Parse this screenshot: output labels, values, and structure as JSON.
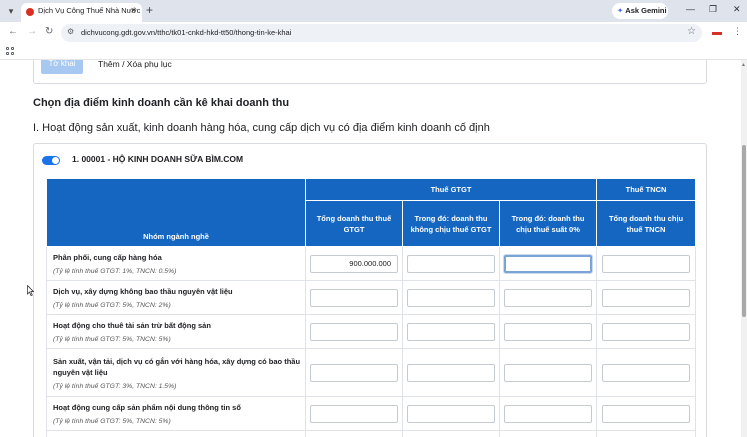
{
  "browser": {
    "tab_title": "Dịch Vụ Công Thuế Nhà Nước",
    "new_tab_symbol": "+",
    "ask_gemini_label": "Ask Gemini",
    "url": "dichvucong.gdt.gov.vn/tthc/tk01-cnkd-hkd-tt50/thong-tin-ke-khai",
    "colors": {
      "tabstrip": "#dfe3eb",
      "accent": "#1a73e8",
      "table_header": "#1566c0"
    }
  },
  "page": {
    "top_buttons": {
      "tokhai_label": "Tờ khai",
      "phuluc_label": "Thêm / Xóa phụ lục"
    },
    "section_title": "Chọn địa điểm kinh doanh cần kê khai doanh thu",
    "subsection_title": "I. Hoạt động sản xuất, kinh doanh hàng hóa, cung cấp dịch vụ có địa điểm kinh doanh cố định",
    "business": {
      "enabled": true,
      "title": "1. 00001 - HỘ KINH DOANH SỮA BÌM.COM"
    },
    "table": {
      "header": {
        "nhom": "Nhóm ngành nghề",
        "gtgt_group": "Thuế GTGT",
        "tncn_group": "Thuế TNCN",
        "col_tong_gtgt": "Tổng doanh thu thuế GTGT",
        "col_khong_chiu": "Trong đó: doanh thu không chịu thuế GTGT",
        "col_ts0": "Trong đó: doanh thu chịu thuế suất 0%",
        "col_tong_tncn": "Tổng doanh thu chịu thuế TNCN"
      },
      "rows": [
        {
          "title": "Phân phối, cung cấp hàng hóa",
          "rate": "(Tỷ lệ tính thuế GTGT: 1%, TNCN: 0.5%)",
          "values": [
            "900.000.000",
            "",
            "",
            ""
          ]
        },
        {
          "title": "Dịch vụ, xây dựng không bao thầu nguyên vật liệu",
          "rate": "(Tỷ lệ tính thuế GTGT: 5%, TNCN: 2%)",
          "values": [
            "",
            "",
            "",
            ""
          ]
        },
        {
          "title": "Hoạt động cho thuê tài sản trừ bất động sản",
          "rate": "(Tỷ lệ tính thuế GTGT: 5%, TNCN: 5%)",
          "values": [
            "",
            "",
            "",
            ""
          ]
        },
        {
          "title": "Sản xuất, vận tải, dịch vụ có gắn với hàng hóa, xây dựng có bao thầu nguyên vật liệu",
          "rate": "(Tỷ lệ tính thuế GTGT: 3%, TNCN: 1.5%)",
          "values": [
            "",
            "",
            "",
            ""
          ]
        },
        {
          "title": "Hoạt động cung cấp sản phẩm nội dung thông tin số",
          "rate": "(Tỷ lệ tính thuế GTGT: 5%, TNCN: 5%)",
          "values": [
            "",
            "",
            "",
            ""
          ]
        }
      ]
    }
  }
}
